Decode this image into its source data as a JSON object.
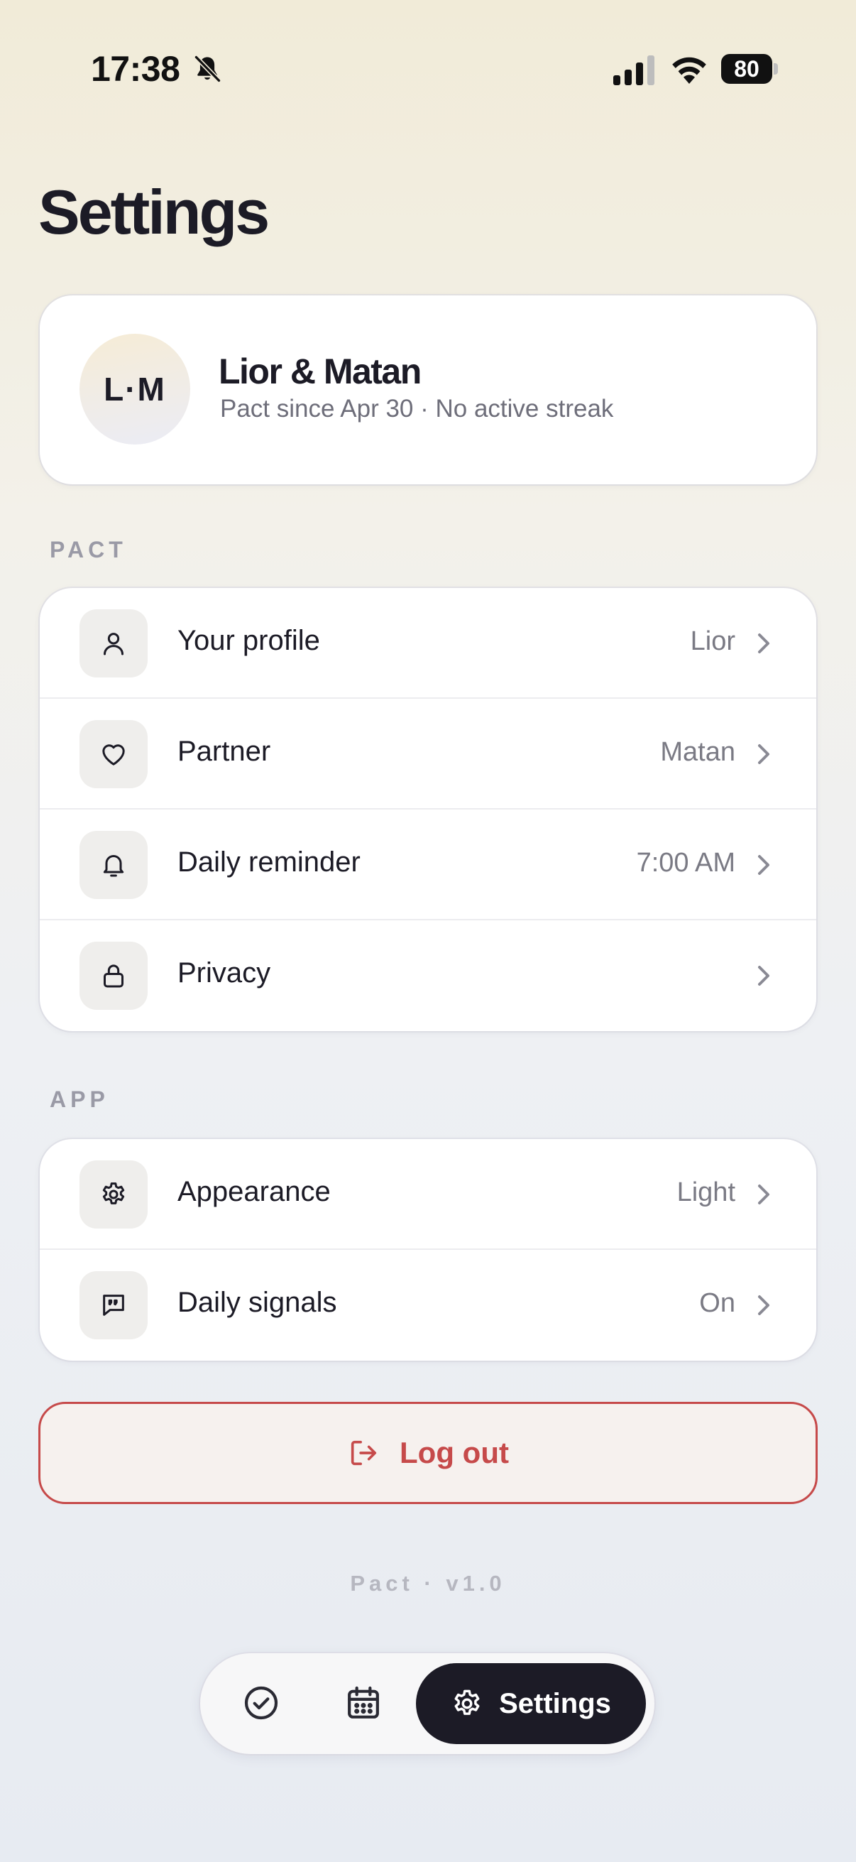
{
  "status_bar": {
    "time": "17:38",
    "battery": "80"
  },
  "page": {
    "title": "Settings"
  },
  "profile": {
    "initials": "L·M",
    "names": "Lior & Matan",
    "subtitle": "Pact since Apr 30 · No active streak"
  },
  "sections": {
    "pact": {
      "label": "PACT",
      "items": [
        {
          "label": "Your profile",
          "value": "Lior",
          "icon": "user-icon"
        },
        {
          "label": "Partner",
          "value": "Matan",
          "icon": "heart-icon"
        },
        {
          "label": "Daily reminder",
          "value": "7:00 AM",
          "icon": "bell-icon"
        },
        {
          "label": "Privacy",
          "value": "",
          "icon": "lock-icon"
        }
      ]
    },
    "app": {
      "label": "APP",
      "items": [
        {
          "label": "Appearance",
          "value": "Light",
          "icon": "gear-icon"
        },
        {
          "label": "Daily signals",
          "value": "On",
          "icon": "quote-bubble-icon"
        }
      ]
    }
  },
  "logout": {
    "label": "Log out"
  },
  "footer": {
    "version": "Pact · v1.0"
  },
  "tab_bar": {
    "settings_label": "Settings"
  },
  "colors": {
    "accent_dark": "#1c1b26",
    "danger": "#c64a4a",
    "muted": "#7a7a84"
  }
}
